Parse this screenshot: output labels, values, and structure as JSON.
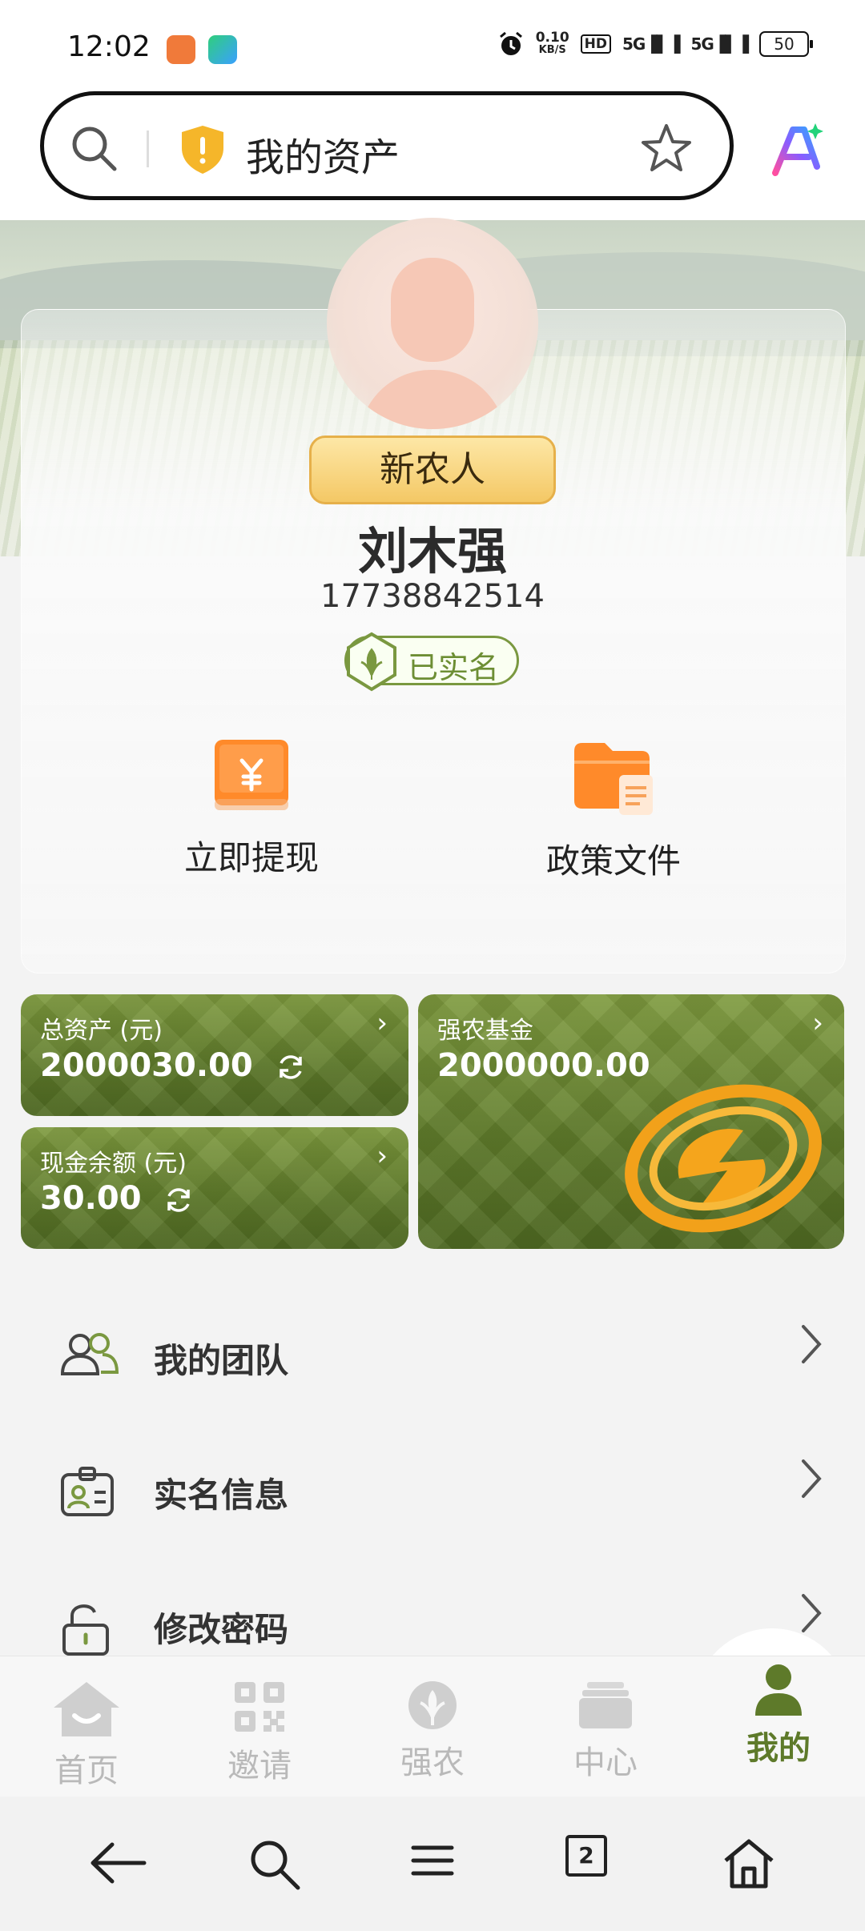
{
  "status_bar": {
    "time": "12:02",
    "net_speed_value": "0.10",
    "net_speed_unit": "KB/S",
    "hd": "HD",
    "signal1": "5G",
    "signal2": "5G",
    "battery": "50"
  },
  "search_bar": {
    "title": "我的资产",
    "icons": [
      "search-icon",
      "shield-icon",
      "star-icon",
      "ai-icon"
    ]
  },
  "profile": {
    "rank": "新农人",
    "name": "刘木强",
    "phone": "17738842514",
    "verified_label": "已实名"
  },
  "actions": [
    {
      "label": "立即提现",
      "icon": "withdraw-icon"
    },
    {
      "label": "政策文件",
      "icon": "folder-icon"
    }
  ],
  "assets": {
    "total": {
      "label": "总资产 (元)",
      "value": "2000030.00"
    },
    "cash": {
      "label": "现金余额 (元)",
      "value": "30.00"
    },
    "fund": {
      "label": "强农基金",
      "value": "2000000.00"
    },
    "arrow": "›"
  },
  "menu": [
    {
      "label": "我的团队",
      "icon": "team-icon"
    },
    {
      "label": "实名信息",
      "icon": "id-card-icon"
    },
    {
      "label": "修改密码",
      "icon": "lock-icon"
    }
  ],
  "tabs": [
    {
      "label": "首页",
      "icon": "home-icon"
    },
    {
      "label": "邀请",
      "icon": "qr-icon"
    },
    {
      "label": "强农",
      "icon": "wheat-icon"
    },
    {
      "label": "中心",
      "icon": "stack-icon"
    },
    {
      "label": "我的",
      "icon": "user-icon",
      "active": true
    }
  ],
  "system_nav": {
    "tab_count": "2",
    "icons": [
      "back-icon",
      "search-icon",
      "menu-icon",
      "tabs-icon",
      "home-icon"
    ]
  },
  "colors": {
    "accent": "#5e7a2a",
    "card_green": "#6b8a32",
    "badge_gold": "#f4c865",
    "orange": "#f57c2a"
  }
}
